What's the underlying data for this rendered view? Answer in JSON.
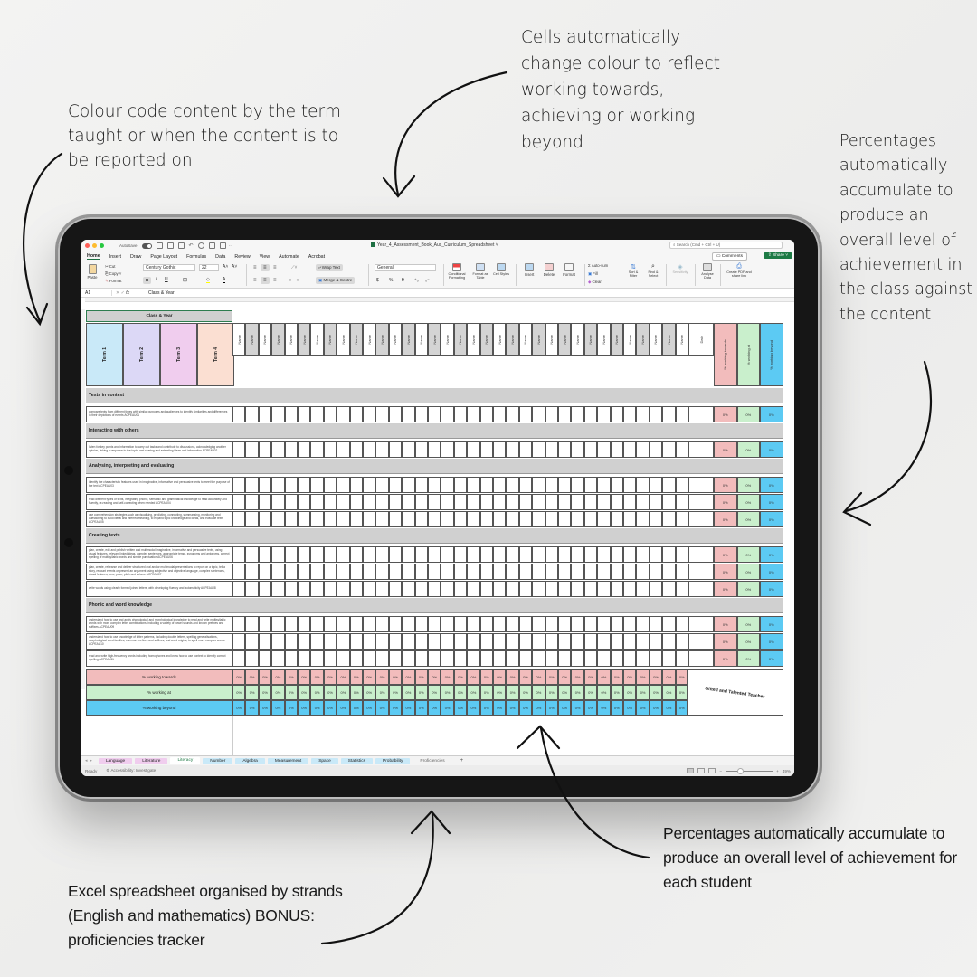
{
  "annotations": {
    "top_left": "Colour code content by the term taught or when the content is to be reported on",
    "top_center": "Cells automatically change colour to reflect working towards, achieving or working beyond",
    "top_right": "Percentages automatically accumulate to produce an overall level of achievement in the class against the content",
    "bottom_right": "Percentages automatically accumulate to produce an overall level of achievement for each student",
    "bottom_left": "Excel spreadsheet organised by strands (English and mathematics) BONUS: proficiencies tracker"
  },
  "window": {
    "title": "Year_4_Assessment_Book_Aus_Curriculum_Spreadsheet ˅",
    "autosave_label": "AutoSave",
    "search_placeholder": "Search (Cmd + Ctrl + U)",
    "comments_label": "Comments",
    "share_label": "Share ˅"
  },
  "menu": [
    "Home",
    "Insert",
    "Draw",
    "Page Layout",
    "Formulas",
    "Data",
    "Review",
    "View",
    "Automate",
    "Acrobat"
  ],
  "ribbon": {
    "paste": "Paste",
    "cut": "Cut",
    "copy": "Copy ˅",
    "format_painter": "Format",
    "font_name": "Century Gothic",
    "font_size": "22",
    "bold": "B",
    "italic": "I",
    "underline": "U",
    "wrap_text": "Wrap Text",
    "merge_centre": "Merge & Centre",
    "number_format": "General",
    "currency": "$",
    "percent": "%",
    "comma": "9",
    "conditional_formatting": "Conditional Formatting",
    "format_as_table": "Format as Table",
    "cell_styles": "Cell Styles",
    "insert": "Insert",
    "delete": "Delete",
    "format": "Format",
    "autosum": "Auto-sum",
    "fill": "Fill",
    "clear": "Clear",
    "sort_filter": "Sort & Filter",
    "find_select": "Find & Select",
    "sensitivity": "Sensitivity",
    "analyse_data": "Analyse Data",
    "create_pdf": "Create PDF and share link"
  },
  "formula_bar": {
    "cell_ref": "A1",
    "fx": "fx",
    "content": "Class & Year"
  },
  "sheet": {
    "class_year": "Class & Year",
    "terms": [
      {
        "label": "Term 1",
        "color": "#c9e9f8"
      },
      {
        "label": "Term 2",
        "color": "#dcd8f6"
      },
      {
        "label": "Term 3",
        "color": "#f0cdee"
      },
      {
        "label": "Term 4",
        "color": "#fbdfd2"
      }
    ],
    "student_header": "Name",
    "student_count": 35,
    "date_header": "Date",
    "summary_headers": [
      {
        "label": "% working towards",
        "color": "#f2bcbc"
      },
      {
        "label": "% working at",
        "color": "#c9efcc"
      },
      {
        "label": "% working beyond",
        "color": "#5ccaf3"
      }
    ],
    "rows": [
      {
        "type": "strand",
        "label": "Texts in context"
      },
      {
        "type": "item",
        "text": "compare texts from different times with similar purposes and audiences to identify similarities and differences in their depictions of events ACPEAU01"
      },
      {
        "type": "strand",
        "label": "Interacting with others"
      },
      {
        "type": "item",
        "text": "listen for key points and information to carry out tasks and contribute to discussions, acknowledging another opinion, linking a response to the topic, and sharing and extending ideas and information ACPEAU02"
      },
      {
        "type": "strand",
        "label": "Analysing, interpreting and evaluating"
      },
      {
        "type": "item",
        "text": "identify the characteristic features used in imaginative, informative and persuasive texts to meet the purpose of the text ACPEAU03"
      },
      {
        "type": "item",
        "text": "read different types of texts, integrating phonic, semantic and grammatical knowledge to read accurately and fluently, re-reading and self-correcting when needed ACPEAU04"
      },
      {
        "type": "item",
        "text": "use comprehension strategies such as visualising, predicting, connecting, summarising, monitoring and questioning to build literal and inferred meaning, to expand topic knowledge and ideas, and evaluate texts ACPEAU05"
      },
      {
        "type": "strand",
        "label": "Creating texts"
      },
      {
        "type": "item",
        "text": "plan, create, edit and publish written and multimodal imaginative, informative and persuasive texts, using visual features, relevant linked ideas, complex sentences, appropriate tense, synonyms and antonyms, correct spelling of multisyllabic words and simple punctuation ACPEAU06"
      },
      {
        "type": "item",
        "text": "plan, create, rehearse and deliver structured oral and/or multimodal presentations to report on a topic, tell a story, recount events or present an argument using subjective and objective language, complex sentences, visual features, tone, pace, pitch and volume ACPEAU07"
      },
      {
        "type": "item",
        "text": "write words using clearly formed joined letters, with developing fluency and automaticity ACPEAU08"
      },
      {
        "type": "strand",
        "label": "Phonic and word knowledge"
      },
      {
        "type": "item",
        "text": "understand how to use and apply phonological and morphological knowledge to read and write multisyllabic words with more complex letter combinations, including a variety of vowel sounds and known prefixes and suffixes ACPEAU09"
      },
      {
        "type": "item",
        "text": "understand how to use knowledge of letter patterns, including double letters, spelling generalisations, morphological word families, common prefixes and suffixes, and word origins, to spell more complex words ACPEAU10"
      },
      {
        "type": "item",
        "text": "read and write high-frequency words including homophones and know how to use context to identify correct spelling ACPEAU11"
      }
    ],
    "item_percent": "0%",
    "totals": [
      {
        "label": "% working towards",
        "color": "#f2bcbc",
        "value": "0%"
      },
      {
        "label": "% working at",
        "color": "#c9efcc",
        "value": "0%"
      },
      {
        "label": "% working beyond",
        "color": "#5ccaf3",
        "value": "0%"
      }
    ],
    "logo_text": "Gifted and Talented Teacher"
  },
  "sheet_tabs": [
    {
      "label": "Language",
      "color": "#f0cdee",
      "active": false
    },
    {
      "label": "Literature",
      "color": "#f0cdee",
      "active": false
    },
    {
      "label": "Literacy",
      "color": "#ffffff",
      "active": true
    },
    {
      "label": "Number",
      "color": "#c9e9f8",
      "active": false
    },
    {
      "label": "Algebra",
      "color": "#c9e9f8",
      "active": false
    },
    {
      "label": "Measurement",
      "color": "#c9e9f8",
      "active": false
    },
    {
      "label": "Space",
      "color": "#c9e9f8",
      "active": false
    },
    {
      "label": "Statistics",
      "color": "#c9e9f8",
      "active": false
    },
    {
      "label": "Probability",
      "color": "#c9e9f8",
      "active": false
    },
    {
      "label": "Proficiencies",
      "color": "#f3f3f3",
      "active": false
    }
  ],
  "add_sheet": "+",
  "status": {
    "ready": "Ready",
    "accessibility": "Accessibility: Investigate",
    "zoom": "49%"
  }
}
